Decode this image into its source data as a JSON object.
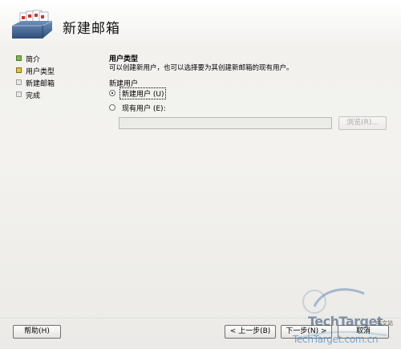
{
  "wizard": {
    "title": "新建邮箱"
  },
  "nav": {
    "items": [
      {
        "label": "简介",
        "state": "done"
      },
      {
        "label": "用户类型",
        "state": "current"
      },
      {
        "label": "新建邮箱",
        "state": "pending"
      },
      {
        "label": "完成",
        "state": "pending"
      }
    ]
  },
  "section": {
    "title": "用户类型",
    "description": "可以创建新用户，也可以选择要为其创建新邮箱的现有用户。",
    "group_label": "新建用户",
    "options": [
      {
        "label": "新建用户 (U)",
        "checked": true
      },
      {
        "label": "现有用户 (E):",
        "checked": false
      }
    ],
    "existing_user_value": "",
    "browse_label": "浏览(R)..."
  },
  "footer": {
    "help_label": "帮助(H)",
    "back_label": "< 上一步(B)",
    "next_label": "下一步(N) >",
    "cancel_label": "取消"
  },
  "watermark": {
    "brand": "TechTarget",
    "tag": "中文站",
    "url": "TechTarget.com.cn"
  },
  "colors": {
    "nav_done": "#79b84a",
    "nav_current": "#e5c23a",
    "nav_pending": "#e8e8e8"
  }
}
